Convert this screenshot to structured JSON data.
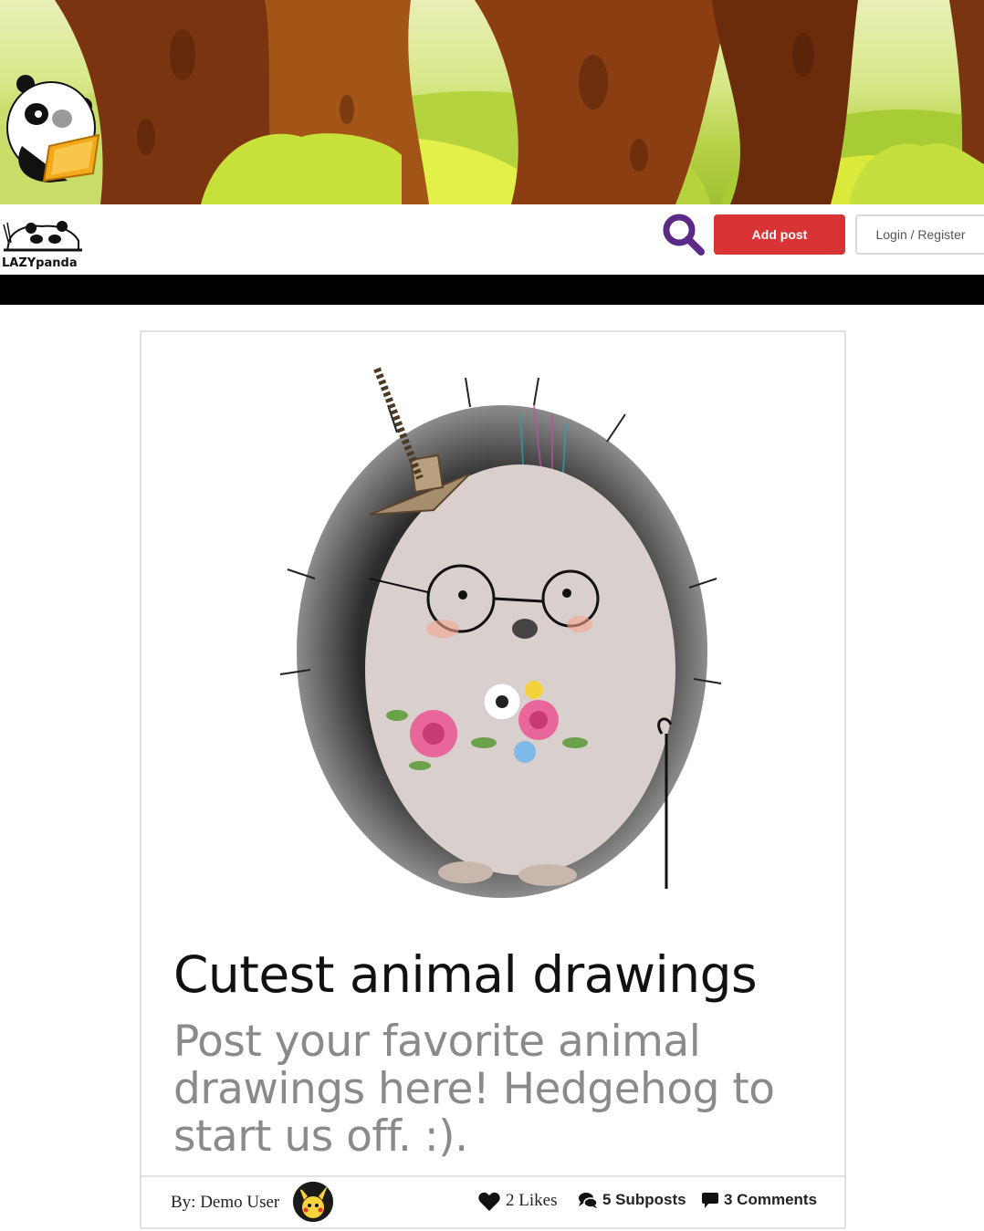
{
  "header": {
    "add_post_label": "Add post",
    "login_label": "Login / Register",
    "logo_text": "LAZYpanda"
  },
  "post": {
    "title": "Cutest animal drawings",
    "description": "Post your favorite animal drawings here! Hedgehog to start us off. :).",
    "author": "By: Demo User",
    "likes": "2 Likes",
    "subposts": "5 Subposts",
    "comments": "3 Comments"
  },
  "icons": {
    "search": "search-icon",
    "likes": "heart-icon",
    "subposts": "comments-icon",
    "comments": "comment-icon"
  },
  "colors": {
    "accent": "#d93435",
    "search": "#5b2a86",
    "bar": "#000000"
  }
}
